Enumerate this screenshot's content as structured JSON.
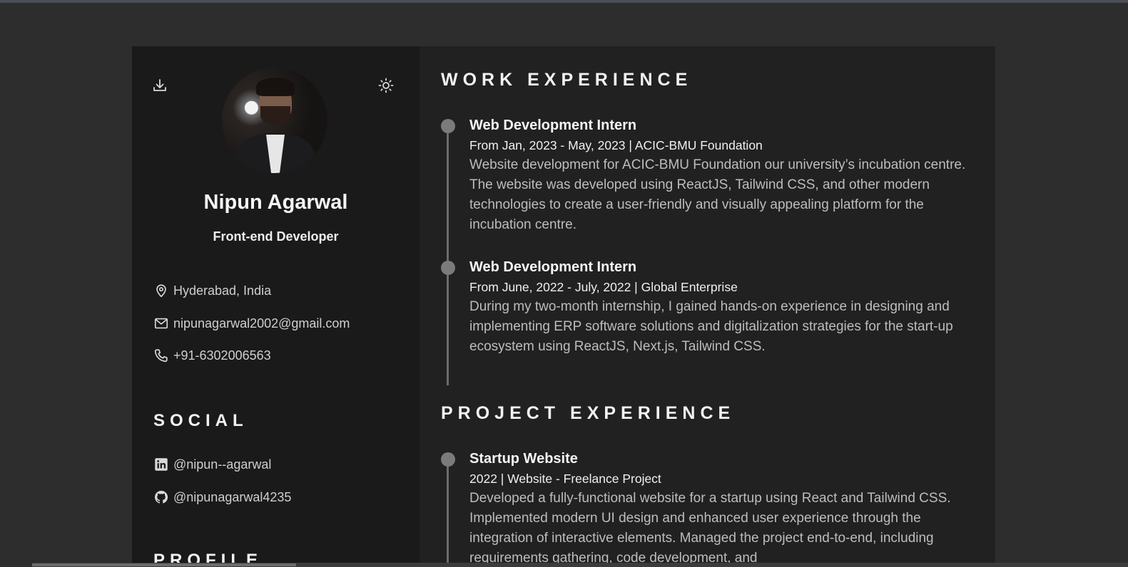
{
  "profile": {
    "name": "Nipun Agarwal",
    "role": "Front-end Developer",
    "location": "Hyderabad, India",
    "email": "nipunagarwal2002@gmail.com",
    "phone": "+91-6302006563"
  },
  "social": {
    "title": "SOCIAL",
    "linkedin": "@nipun--agarwal",
    "github": "@nipunagarwal4235"
  },
  "profile_section": {
    "title": "PROFILE"
  },
  "work": {
    "title": "WORK EXPERIENCE",
    "items": [
      {
        "title": "Web Development Intern",
        "meta": "From Jan, 2023 - May, 2023 | ACIC-BMU Foundation",
        "desc": "Website development for ACIC-BMU Foundation our university’s incubation centre. The website was developed using ReactJS, Tailwind CSS, and other modern technologies to create a user-friendly and visually appealing platform for the incubation centre."
      },
      {
        "title": "Web Development Intern",
        "meta": "From June, 2022 - July, 2022 | Global Enterprise",
        "desc": "During my two-month internship, I gained hands-on experience in designing and implementing ERP software solutions and digitalization strategies for the start-up ecosystem using ReactJS, Next.js, Tailwind CSS."
      }
    ]
  },
  "projects": {
    "title": "PROJECT EXPERIENCE",
    "items": [
      {
        "title": "Startup Website",
        "meta": "2022 | Website - Freelance Project",
        "desc": "Developed a fully-functional website for a startup using React and Tailwind CSS. Implemented modern UI design and enhanced user experience through the integration of interactive elements. Managed the project end-to-end, including requirements gathering, code development, and"
      }
    ]
  },
  "icons": {
    "download": "download-icon",
    "theme": "sun-icon",
    "location": "map-pin-icon",
    "email": "mail-icon",
    "phone": "phone-icon",
    "linkedin": "linkedin-icon",
    "github": "github-icon"
  },
  "colors": {
    "page_bg": "#2d2d2d",
    "sidebar_bg": "#1b1a1b",
    "main_bg": "#212121",
    "timeline": "#7b7b7b"
  }
}
